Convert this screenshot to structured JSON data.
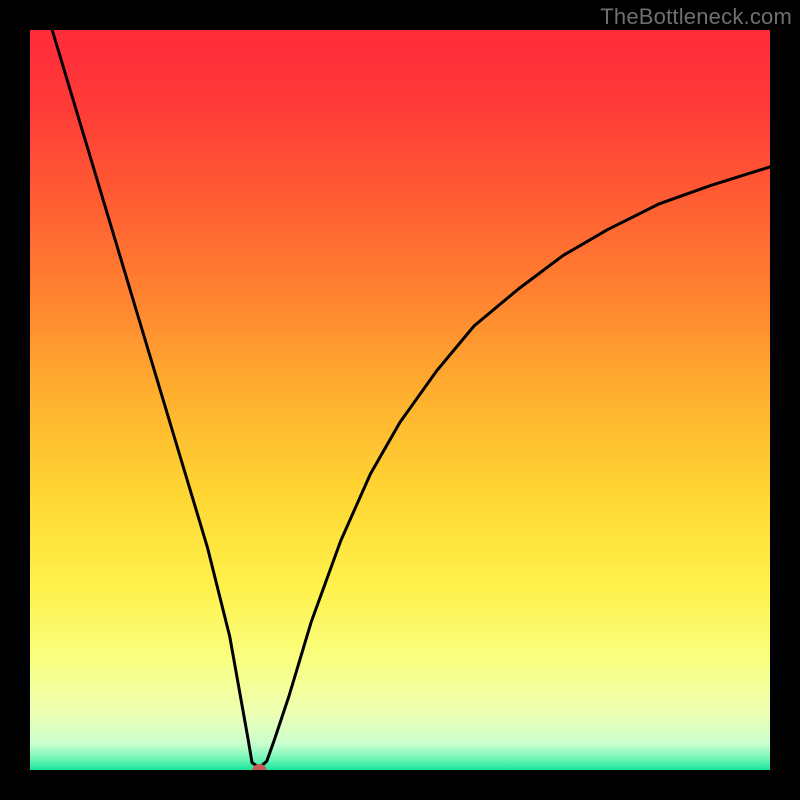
{
  "watermark": "TheBottleneck.com",
  "chart_data": {
    "type": "line",
    "title": "",
    "xlabel": "",
    "ylabel": "",
    "xlim": [
      0,
      100
    ],
    "ylim": [
      0,
      100
    ],
    "grid": false,
    "axis_labels_visible": false,
    "marker": {
      "x": 31,
      "y": 0,
      "color": "#c95b57"
    },
    "gradient_stops": [
      {
        "pos": 0.0,
        "color": "#ff2b3a"
      },
      {
        "pos": 0.1,
        "color": "#ff3a38"
      },
      {
        "pos": 0.22,
        "color": "#ff5a33"
      },
      {
        "pos": 0.35,
        "color": "#ff8030"
      },
      {
        "pos": 0.5,
        "color": "#ffb22f"
      },
      {
        "pos": 0.63,
        "color": "#ffd733"
      },
      {
        "pos": 0.75,
        "color": "#fff14a"
      },
      {
        "pos": 0.85,
        "color": "#f9ff80"
      },
      {
        "pos": 0.92,
        "color": "#eeffb0"
      },
      {
        "pos": 0.965,
        "color": "#c9ffce"
      },
      {
        "pos": 0.985,
        "color": "#70f6b8"
      },
      {
        "pos": 1.0,
        "color": "#18e59a"
      }
    ],
    "series": [
      {
        "name": "bottleneck-curve",
        "x": [
          3,
          6,
          9,
          12,
          15,
          18,
          21,
          24,
          27,
          29.5,
          30,
          31,
          32,
          33,
          35,
          38,
          42,
          46,
          50,
          55,
          60,
          66,
          72,
          78,
          85,
          92,
          100
        ],
        "y": [
          100,
          90,
          80,
          70,
          60,
          50,
          40,
          30,
          18,
          4,
          1,
          0.3,
          1.2,
          4,
          10,
          20,
          31,
          40,
          47,
          54,
          60,
          65,
          69.5,
          73,
          76.5,
          79,
          81.5
        ]
      }
    ]
  }
}
